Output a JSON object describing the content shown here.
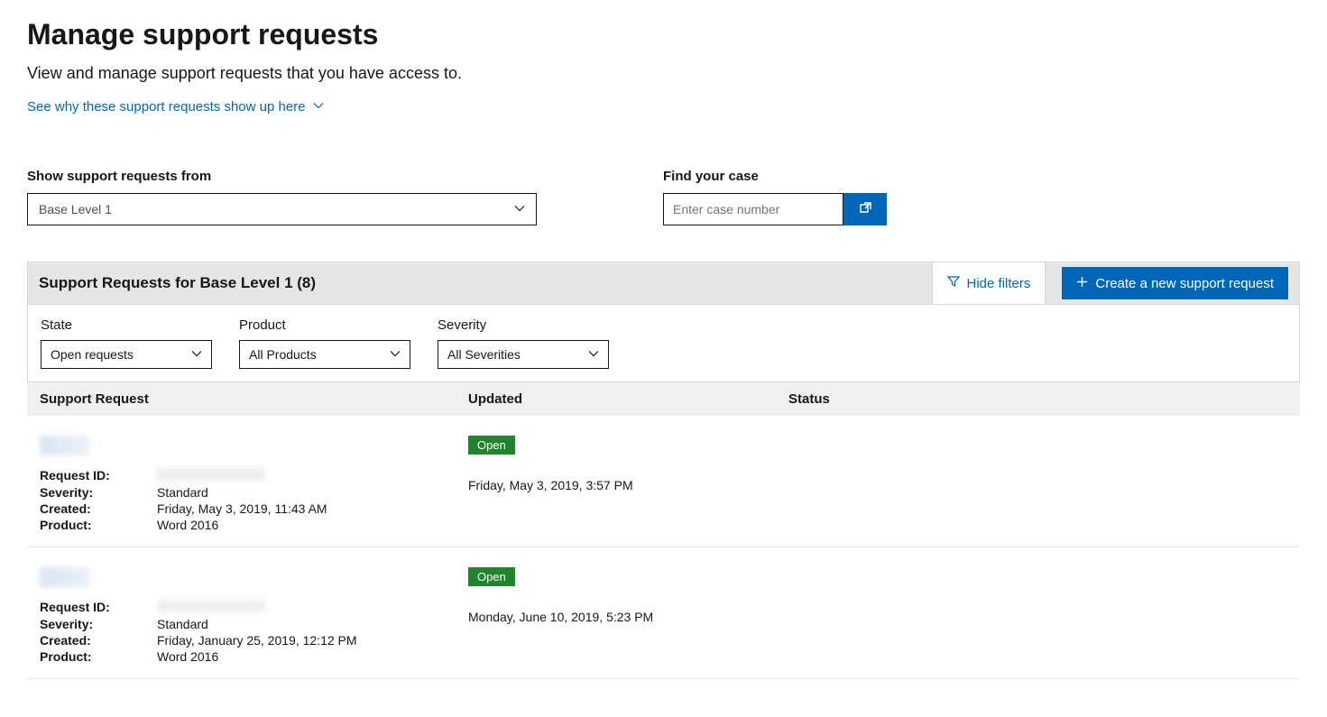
{
  "page": {
    "title": "Manage support requests",
    "subtitle": "View and manage support requests that you have access to.",
    "why_link": "See why these support requests show up here"
  },
  "scope": {
    "label": "Show support requests from",
    "value": "Base Level 1"
  },
  "find": {
    "label": "Find your case",
    "placeholder": "Enter case number"
  },
  "panel": {
    "title": "Support Requests for Base Level 1 (8)",
    "hide_filters": "Hide filters",
    "create": "Create a new support request"
  },
  "filters": {
    "state": {
      "label": "State",
      "value": "Open requests"
    },
    "product": {
      "label": "Product",
      "value": "All Products"
    },
    "severity": {
      "label": "Severity",
      "value": "All Severities"
    }
  },
  "columns": {
    "request": "Support Request",
    "updated": "Updated",
    "status": "Status"
  },
  "field_labels": {
    "request_id": "Request ID:",
    "severity": "Severity:",
    "created": "Created:",
    "product": "Product:"
  },
  "rows": [
    {
      "request_id": "",
      "severity": "Standard",
      "created": "Friday, May 3, 2019, 11:43 AM",
      "product": "Word 2016",
      "badge": "Open",
      "updated": "Friday, May 3, 2019, 3:57 PM"
    },
    {
      "request_id": "",
      "severity": "Standard",
      "created": "Friday, January 25, 2019, 12:12 PM",
      "product": "Word 2016",
      "badge": "Open",
      "updated": "Monday, June 10, 2019, 5:23 PM"
    }
  ]
}
